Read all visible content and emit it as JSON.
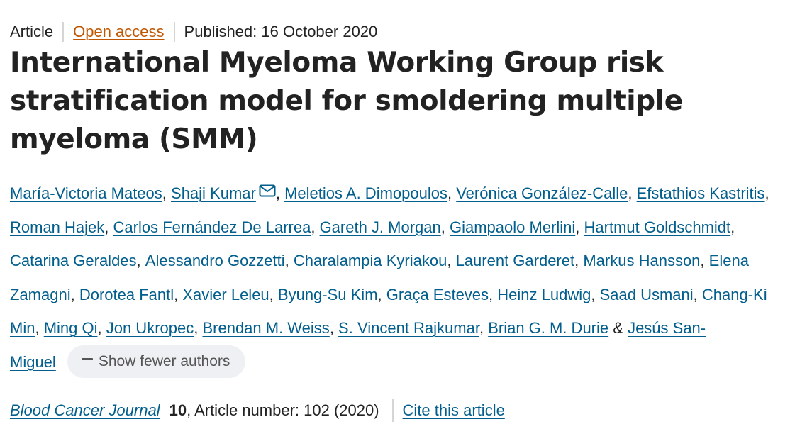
{
  "meta": {
    "type": "Article",
    "access": "Open access",
    "published": "Published: 16 October 2020"
  },
  "title": "International Myeloma Working Group risk stratification model for smoldering multiple myeloma (SMM)",
  "authors": [
    {
      "name": "María-Victoria Mateos"
    },
    {
      "name": "Shaji Kumar"
    },
    {
      "name": "Meletios A. Dimopoulos"
    },
    {
      "name": "Verónica González-Calle"
    },
    {
      "name": "Efstathios Kastritis"
    },
    {
      "name": "Roman Hajek"
    },
    {
      "name": "Carlos Fernández De Larrea"
    },
    {
      "name": "Gareth J. Morgan"
    },
    {
      "name": "Giampaolo Merlini"
    },
    {
      "name": "Hartmut Goldschmidt"
    },
    {
      "name": "Catarina Geraldes"
    },
    {
      "name": "Alessandro Gozzetti"
    },
    {
      "name": "Charalampia Kyriakou"
    },
    {
      "name": "Laurent Garderet"
    },
    {
      "name": "Markus Hansson"
    },
    {
      "name": "Elena Zamagni"
    },
    {
      "name": "Dorotea Fantl"
    },
    {
      "name": "Xavier Leleu"
    },
    {
      "name": "Byung-Su Kim"
    },
    {
      "name": "Graça Esteves"
    },
    {
      "name": "Heinz Ludwig"
    },
    {
      "name": "Saad Usmani"
    },
    {
      "name": "Chang-Ki Min"
    },
    {
      "name": "Ming Qi"
    },
    {
      "name": "Jon Ukropec"
    },
    {
      "name": "Brendan M. Weiss"
    },
    {
      "name": "S. Vincent Rajkumar"
    },
    {
      "name": "Brian G. M. Durie"
    },
    {
      "name": "Jesús San-Miguel"
    }
  ],
  "corresponding_icon": "envelope-icon",
  "show_fewer": {
    "label": "Show fewer authors",
    "icon": "minus-icon"
  },
  "citation": {
    "journal": "Blood Cancer Journal",
    "volume": "10",
    "rest": ", Article number: 102 (2020)",
    "cite_label": "Cite this article"
  },
  "colors": {
    "link": "#025e8d",
    "open_access": "#c05600",
    "text": "#222222",
    "pill_bg": "#eef0f3"
  }
}
